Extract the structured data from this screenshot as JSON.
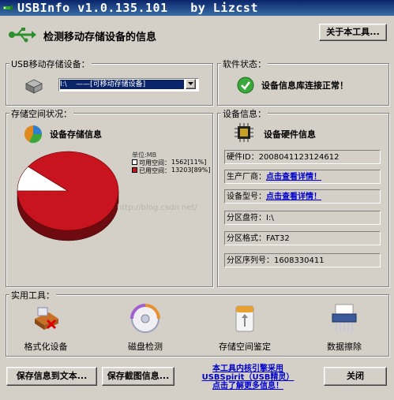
{
  "window": {
    "title": "USBInfo v1.0.135.101   by Lizcst"
  },
  "header": {
    "heading": "检测移动存储设备的信息",
    "about_button": "关于本工具..."
  },
  "device_group": {
    "label": "USB移动存储设备：",
    "selected": "I:\\    ——[可移动存储设备]"
  },
  "status_group": {
    "label": "软件状态：",
    "message": "设备信息库连接正常！"
  },
  "storage_group": {
    "label": "存储空间状况：",
    "title": "设备存储信息",
    "unit": "单位:MB",
    "legend": [
      {
        "label": "可用空间：",
        "value": "1562[11%]",
        "color": "#ffffff"
      },
      {
        "label": "已用空间：",
        "value": "13203[89%]",
        "color": "#c8141e"
      }
    ]
  },
  "chart_data": {
    "type": "pie",
    "unit": "MB",
    "slices": [
      {
        "label": "可用空间",
        "value": 1562,
        "percent": 11,
        "color": "#ffffff"
      },
      {
        "label": "已用空间",
        "value": 13203,
        "percent": 89,
        "color": "#c8141e"
      }
    ]
  },
  "hardware_group": {
    "label": "设备信息：",
    "title": "设备硬件信息",
    "hardware_id": "硬件ID：2008041123124612",
    "vendor_label": "生产厂商：",
    "vendor_link": "点击查看详情！",
    "model_label": "设备型号：",
    "model_link": "点击查看详情！",
    "drive_letter": "分区盘符：I:\\",
    "format": "分区格式：FAT32",
    "serial": "分区序列号：1608330411"
  },
  "tools_group": {
    "label": "实用工具：",
    "items": [
      {
        "label": "格式化设备",
        "icon": "format-icon"
      },
      {
        "label": "磁盘检测",
        "icon": "disk-check-icon"
      },
      {
        "label": "存储空间鉴定",
        "icon": "space-verify-icon"
      },
      {
        "label": "数据擦除",
        "icon": "shredder-icon"
      }
    ]
  },
  "watermark": "http://blog.csdn.net/",
  "footer": {
    "save_text_button": "保存信息到文本...",
    "save_image_button": "保存截图信息...",
    "link_line1": "本工具内核引擎采用",
    "link_line2": "USBSpirit（USB精灵）",
    "link_line3": "点击了解更多信息！",
    "close_button": "关闭"
  }
}
